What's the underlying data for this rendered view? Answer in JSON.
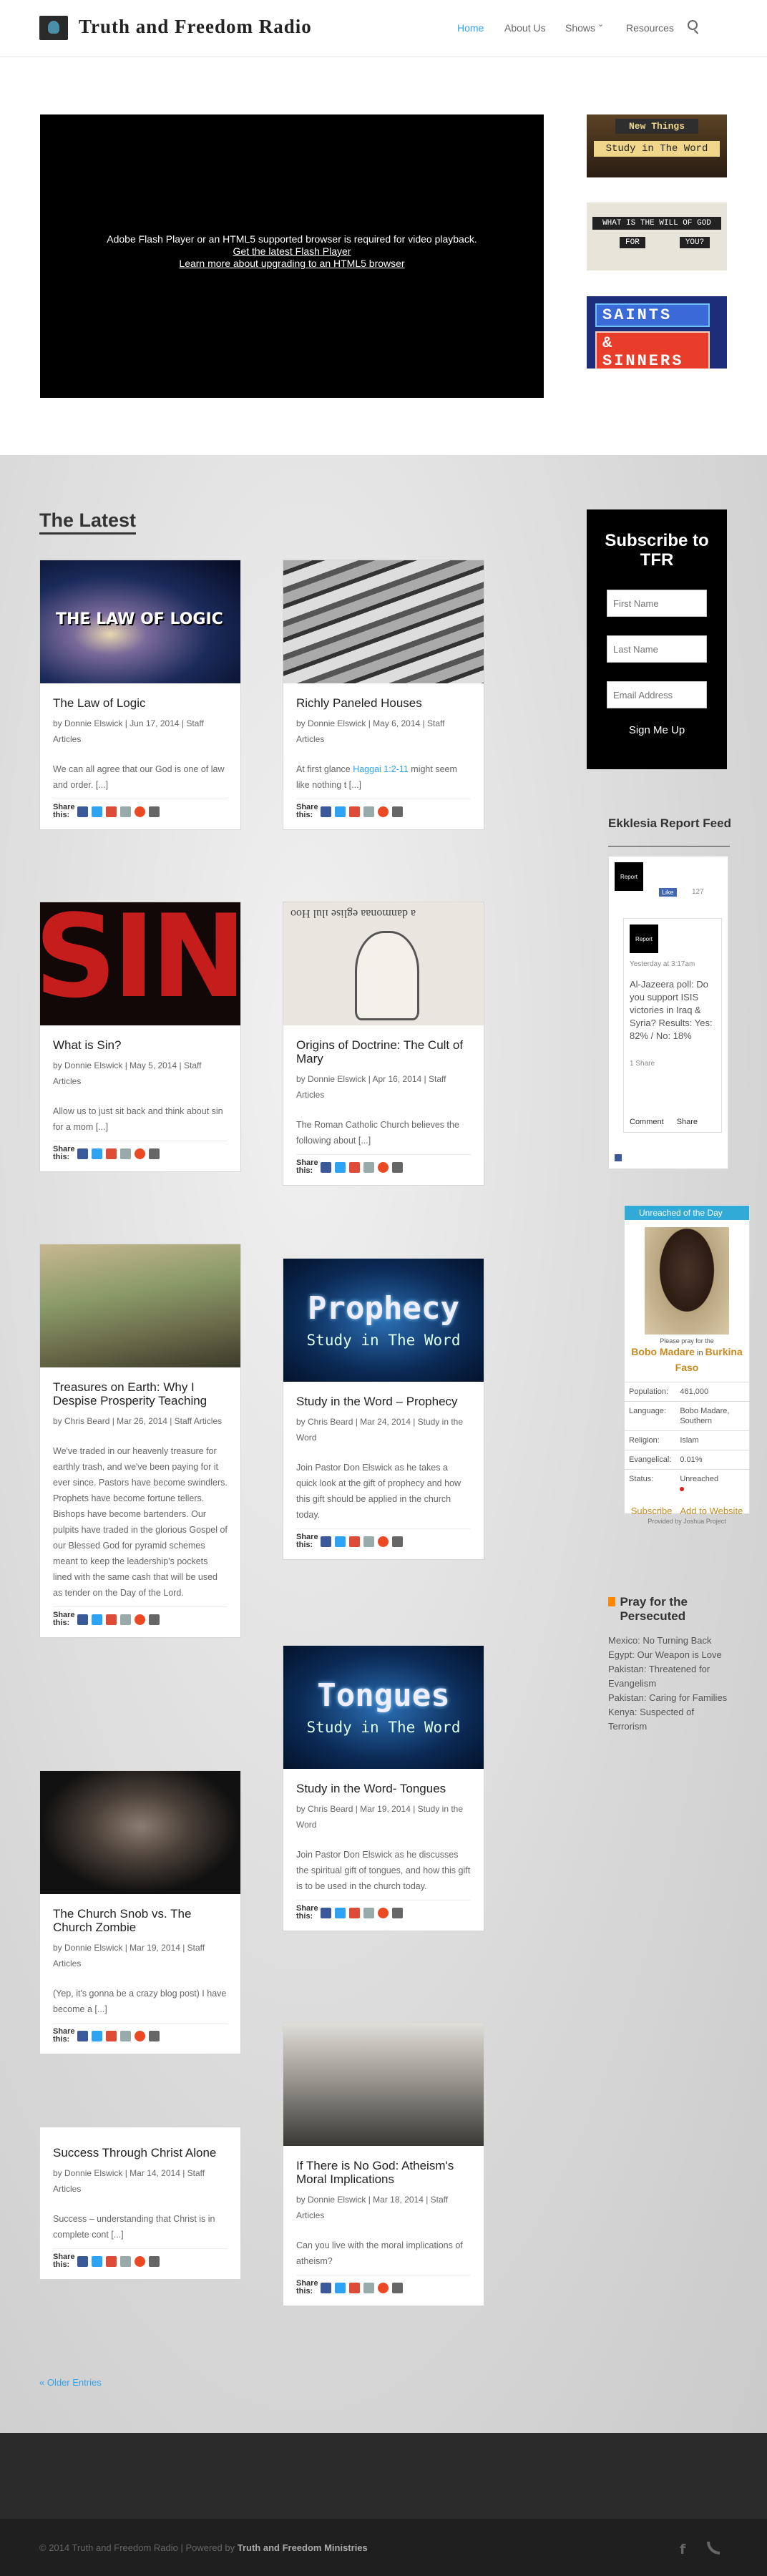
{
  "header": {
    "site_title": "Truth and Freedom Radio",
    "nav": [
      "Home",
      "About Us",
      "Shows",
      "Resources"
    ],
    "shows_caret": "⌄"
  },
  "hero": {
    "video_message_1": "Adobe Flash Player or an HTML5 supported browser is required for video playback.",
    "video_link_1": "Get the latest Flash Player",
    "video_link_2": "Learn more about upgrading to an HTML5 browser",
    "promo1_line1": "New Things",
    "promo1_line2": "Study in The Word",
    "promo2_line1": "WHAT IS THE WILL OF GOD",
    "promo2_word1": "FOR",
    "promo2_word2": "YOU?",
    "promo3_line1": "SAINTS",
    "promo3_line2": "& SINNERS"
  },
  "main": {
    "heading": "The Latest",
    "share_label": "Share this:",
    "posts": [
      {
        "title": "The Law of Logic",
        "meta": "by Donnie Elswick | Jun 17, 2014 | Staff Articles",
        "excerpt": "We can all agree that our God is one of law and order. [...]",
        "image_text": "THE LAW OF LOGIC"
      },
      {
        "title": "Richly Paneled Houses",
        "meta": "by Donnie Elswick | May 6, 2014 | Staff Articles",
        "excerpt_a": "At first glance ",
        "excerpt_link": "Haggai 1:2-11",
        "excerpt_b": " might seem like nothing t [...]"
      },
      {
        "title": "What is Sin?",
        "meta": "by Donnie Elswick | May 5, 2014 | Staff Articles",
        "excerpt": "Allow us to just sit back and think about sin for a mom [...]",
        "image_text": "SIN"
      },
      {
        "title": "Origins of Doctrine: The Cult of Mary",
        "meta": "by Donnie Elswick | Apr 16, 2014 | Staff Articles",
        "excerpt": "The Roman Catholic Church believes the following about [...]",
        "image_text": "a danmonaa eglise ılul Hoo"
      },
      {
        "title": "Treasures on Earth: Why I Despise Prosperity Teaching",
        "meta": "by Chris Beard | Mar 26, 2014 | Staff Articles",
        "excerpt": "We've traded in our heavenly treasure for earthly trash, and we've been paying for it ever since. Pastors have become swindlers. Prophets have become fortune tellers. Bishops have become bartenders. Our pulpits have traded in the glorious Gospel of our Blessed God for pyramid schemes meant to keep the leadership's pockets lined with the same cash that will be used as tender on the Day of the Lord."
      },
      {
        "title": "Study in the Word – Prophecy",
        "meta": "by Chris Beard | Mar 24, 2014 | Study in the Word",
        "excerpt": "Join Pastor Don Elswick as he takes a quick look at the gift of prophecy and how this gift should be applied in the church today.",
        "image_text_1": "Prophecy",
        "image_text_2": "Study in The Word"
      },
      {
        "title": "Study in the Word- Tongues",
        "meta": "by Chris Beard | Mar 19, 2014 | Study in the Word",
        "excerpt": "Join Pastor Don Elswick as he discusses the spiritual gift of tongues, and how this gift is to be used in the church today.",
        "image_text_1": "Tongues",
        "image_text_2": "Study in The Word"
      },
      {
        "title": "The Church Snob vs. The Church Zombie",
        "meta": "by Donnie Elswick | Mar 19, 2014 | Staff Articles",
        "excerpt": "(Yep, it's gonna be a crazy blog post) I have become a [...]"
      },
      {
        "title": "If There is No God: Atheism's Moral Implications",
        "meta": "by Donnie Elswick | Mar 18, 2014 | Staff Articles",
        "excerpt": "Can you live with the moral implications of atheism?"
      },
      {
        "title": "Success Through Christ Alone",
        "meta": "by Donnie Elswick | Mar 14, 2014 | Staff Articles",
        "excerpt": "Success – understanding that Christ is in complete cont [...]"
      }
    ],
    "older_entries": "« Older Entries"
  },
  "sidebar": {
    "subscribe_title": "Subscribe to TFR",
    "first_name_placeholder": "First Name",
    "last_name_placeholder": "Last Name",
    "email_placeholder": "Email Address",
    "sign_me_up": "Sign Me Up",
    "ekklesia_title": "Ekklesia Report Feed",
    "ekk_logo": "Report",
    "ekk_like": "Like",
    "ekk_likes": "127",
    "ekk_time": "Yesterday at 3:17am",
    "ekk_post": "Al-Jazeera poll: Do you support ISIS victories in Iraq & Syria? Results: Yes: 82% / No: 18%",
    "ekk_shares": "1 Share",
    "ekk_comment": "Comment",
    "ekk_share": "Share",
    "uod_bar": "Unreached of the Day",
    "uod_pray": "Please pray for the",
    "uod_name_a": "Bobo Madare",
    "uod_in": " in ",
    "uod_name_b": "Burkina Faso",
    "uod_rows": [
      {
        "k": "Population:",
        "v": "461,000"
      },
      {
        "k": "Language:",
        "v": "Bobo Madare, Southern"
      },
      {
        "k": "Religion:",
        "v": "Islam"
      },
      {
        "k": "Evangelical:",
        "v": "0.01%"
      },
      {
        "k": "Status:",
        "v": "Unreached"
      }
    ],
    "uod_subscribe": "Subscribe",
    "uod_add": "Add to Website",
    "uod_provided": "Provided by Joshua Project",
    "pray_title": "Pray for the Persecuted",
    "pray_items": [
      "Mexico: No Turning Back",
      "Egypt: Our Weapon is Love",
      "Pakistan: Threatened for Evangelism",
      "Pakistan: Caring for Families",
      "Kenya: Suspected of Terrorism"
    ]
  },
  "footer": {
    "copyright": "© 2014 Truth and Freedom Radio | Powered by ",
    "ministries": "Truth and Freedom Ministries",
    "facebook_glyph": "f"
  },
  "colors": {
    "accent": "#2ea3f2",
    "gold": "#c78a1e"
  }
}
